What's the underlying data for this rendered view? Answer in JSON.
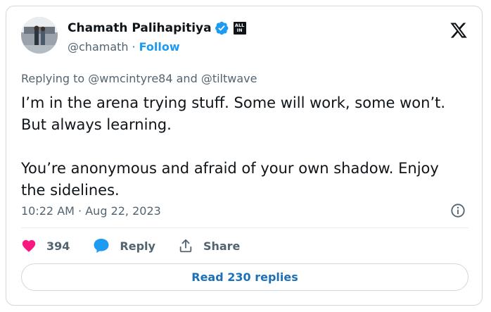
{
  "author": {
    "display_name": "Chamath Palihapitiya",
    "handle": "@chamath",
    "follow_label": "Follow",
    "affiliate_badge": "ALL IN"
  },
  "reply": {
    "prefix": "Replying to ",
    "user1": "@wmcintyre84",
    "conjunction": " and ",
    "user2": "@tiltwave"
  },
  "tweet": {
    "line1": "I’m in the arena trying stuff. Some will work, some won’t.",
    "line2": "But always learning.",
    "line3": "You’re anonymous and afraid of your own shadow. Enjoy",
    "line4": "the sidelines."
  },
  "meta": {
    "time": "10:22 AM",
    "separator": "·",
    "date": "Aug 22, 2023"
  },
  "actions": {
    "like_count": "394",
    "reply_label": "Reply",
    "share_label": "Share"
  },
  "read_replies_label": "Read 230 replies",
  "icons": {
    "verified": "verified-badge-icon",
    "x_logo": "x-logo-icon",
    "info": "info-icon",
    "heart": "heart-icon",
    "reply": "reply-bubble-icon",
    "share": "share-icon"
  },
  "colors": {
    "accent": "#1d9bf0",
    "heart": "#f91880",
    "secondary_text": "#536471",
    "border": "#cfd9de"
  }
}
